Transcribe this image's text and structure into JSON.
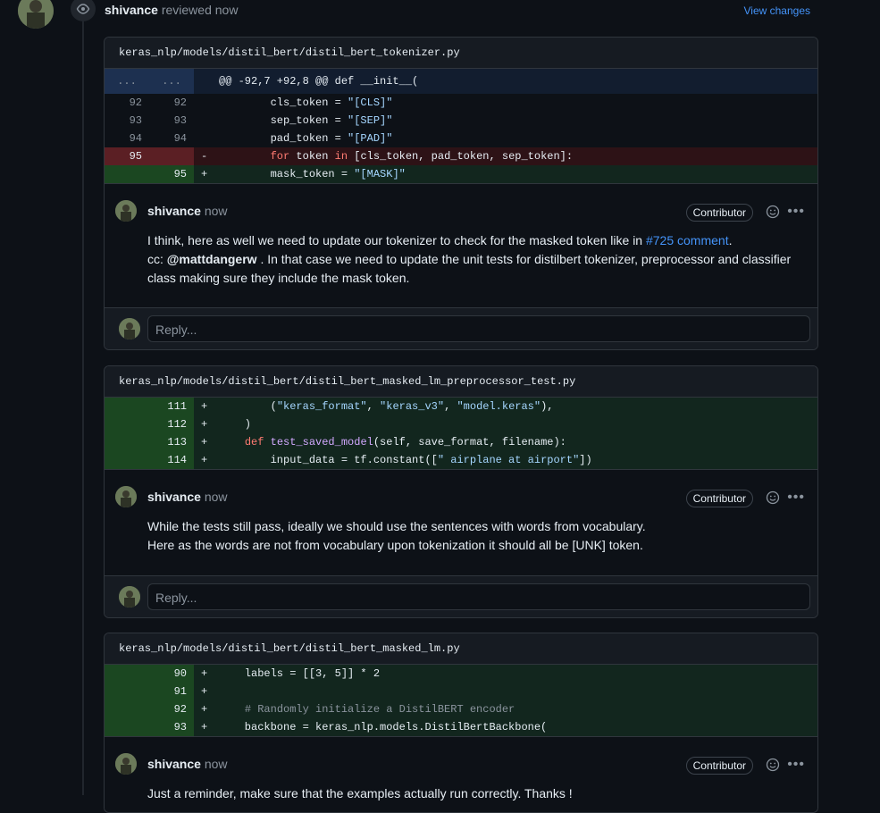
{
  "review": {
    "user": "shivance",
    "action": "reviewed now",
    "view_changes": "View changes"
  },
  "threads": [
    {
      "file": "keras_nlp/models/distil_bert/distil_bert_tokenizer.py",
      "hunk": {
        "left": "...",
        "right": "...",
        "text": "@@ -92,7 +92,8 @@ def __init__("
      },
      "lines": [
        {
          "old": "92",
          "new": "92",
          "sign": "",
          "code": "        cls_token = \"[CLS]\""
        },
        {
          "old": "93",
          "new": "93",
          "sign": "",
          "code": "        sep_token = \"[SEP]\""
        },
        {
          "old": "94",
          "new": "94",
          "sign": "",
          "code": "        pad_token = \"[PAD]\""
        },
        {
          "old": "95",
          "new": "",
          "sign": "-",
          "code": "        for token in [cls_token, pad_token, sep_token]:"
        },
        {
          "old": "",
          "new": "95",
          "sign": "+",
          "code": "        mask_token = \"[MASK]\""
        }
      ],
      "comment": {
        "user": "shivance",
        "time": "now",
        "badge": "Contributor",
        "line1_pre": "I think, here as well we need to update our tokenizer to check for the masked token like in ",
        "line1_link": "#725 comment",
        "line1_post": ".",
        "line2_pre": "cc: ",
        "line2_mention": "@mattdangerw",
        "line2_post": " . In that case we need to update the unit tests for distilbert tokenizer, preprocessor and classifier",
        "line3": "class making sure they include the mask token."
      },
      "reply_placeholder": "Reply..."
    },
    {
      "file": "keras_nlp/models/distil_bert/distil_bert_masked_lm_preprocessor_test.py",
      "lines": [
        {
          "old": "",
          "new": "111",
          "sign": "+",
          "code": "        (\"keras_format\", \"keras_v3\", \"model.keras\"),"
        },
        {
          "old": "",
          "new": "112",
          "sign": "+",
          "code": "    )"
        },
        {
          "old": "",
          "new": "113",
          "sign": "+",
          "code": "    def test_saved_model(self, save_format, filename):"
        },
        {
          "old": "",
          "new": "114",
          "sign": "+",
          "code": "        input_data = tf.constant([\" airplane at airport\"])"
        }
      ],
      "comment": {
        "user": "shivance",
        "time": "now",
        "badge": "Contributor",
        "line1": "While the tests still pass, ideally we should use the sentences with words from vocabulary.",
        "line2": "Here as the words are not from vocabulary upon tokenization it should all be [UNK] token."
      },
      "reply_placeholder": "Reply..."
    },
    {
      "file": "keras_nlp/models/distil_bert/distil_bert_masked_lm.py",
      "lines": [
        {
          "old": "",
          "new": "90",
          "sign": "+",
          "code": "    labels = [[3, 5]] * 2"
        },
        {
          "old": "",
          "new": "91",
          "sign": "+",
          "code": ""
        },
        {
          "old": "",
          "new": "92",
          "sign": "+",
          "code": "    # Randomly initialize a DistilBERT encoder"
        },
        {
          "old": "",
          "new": "93",
          "sign": "+",
          "code": "    backbone = keras_nlp.models.DistilBertBackbone("
        }
      ],
      "comment": {
        "user": "shivance",
        "time": "now",
        "badge": "Contributor",
        "line1": "Just a reminder, make sure that the examples actually run correctly. Thanks !"
      }
    }
  ],
  "colors": {
    "background": "#0d1117",
    "accent_link": "#4493f8",
    "added_bg": "#12261e",
    "deleted_bg": "#2d1216"
  },
  "icons": [
    "eye-icon",
    "smiley-icon",
    "kebab-menu-icon",
    "avatar"
  ]
}
